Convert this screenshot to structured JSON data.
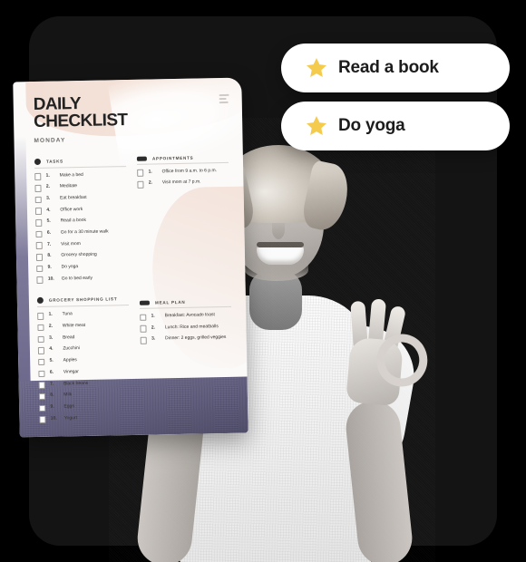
{
  "theme": {
    "background": "#000000",
    "panel": "#141414",
    "card_bg": "#fbfaf9",
    "accent_peach": "#f2ded4",
    "accent_purple": "#5b5878",
    "star_color": "#f5cb4e",
    "pill_bg": "#ffffff",
    "text_dark": "#1c1c1c"
  },
  "pills": [
    {
      "icon": "star-icon",
      "label": "Read a book"
    },
    {
      "icon": "star-icon",
      "label": "Do yoga"
    }
  ],
  "checklist_card": {
    "title_line1": "DAILY",
    "title_line2": "CHECKLIST",
    "subtitle": "MONDAY",
    "menu_icon": "hamburger-menu-icon",
    "sections": [
      {
        "marker": "circle",
        "title": "TASKS",
        "items": [
          {
            "num": "1.",
            "text": "Make a bed"
          },
          {
            "num": "2.",
            "text": "Meditate"
          },
          {
            "num": "3.",
            "text": "Eat breakfast"
          },
          {
            "num": "4.",
            "text": "Office work"
          },
          {
            "num": "5.",
            "text": "Read a book"
          },
          {
            "num": "6.",
            "text": "Go for a 30 minute walk"
          },
          {
            "num": "7.",
            "text": "Visit mom"
          },
          {
            "num": "8.",
            "text": "Grocery shopping"
          },
          {
            "num": "9.",
            "text": "Do yoga"
          },
          {
            "num": "10.",
            "text": "Go to bed early"
          }
        ]
      },
      {
        "marker": "bar",
        "title": "APPOINTMENTS",
        "items": [
          {
            "num": "1.",
            "text": "Office from 9 a.m. to 6 p.m."
          },
          {
            "num": "2.",
            "text": "Visit mom at 7 p.m."
          }
        ]
      },
      {
        "marker": "circle",
        "title": "GROCERY SHOPPING LIST",
        "items": [
          {
            "num": "1.",
            "text": "Tuna"
          },
          {
            "num": "2.",
            "text": "White meat"
          },
          {
            "num": "3.",
            "text": "Bread"
          },
          {
            "num": "4.",
            "text": "Zucchini"
          },
          {
            "num": "5.",
            "text": "Apples"
          },
          {
            "num": "6.",
            "text": "Vinegar"
          },
          {
            "num": "7.",
            "text": "Black beans"
          },
          {
            "num": "8.",
            "text": "Milk"
          },
          {
            "num": "9.",
            "text": "Eggs"
          },
          {
            "num": "10.",
            "text": "Yogurt"
          }
        ]
      },
      {
        "marker": "bar",
        "title": "MEAL PLAN",
        "items": [
          {
            "num": "1.",
            "text": "Breakfast: Avocado toast"
          },
          {
            "num": "2.",
            "text": "Lunch: Rice and meatballs"
          },
          {
            "num": "3.",
            "text": "Dinner: 2 eggs, grilled veggies"
          }
        ]
      }
    ]
  },
  "photo": {
    "description": "Smiling man with blond wavy hair in white t-shirt making OK hand gestures",
    "style": "black-and-white"
  }
}
